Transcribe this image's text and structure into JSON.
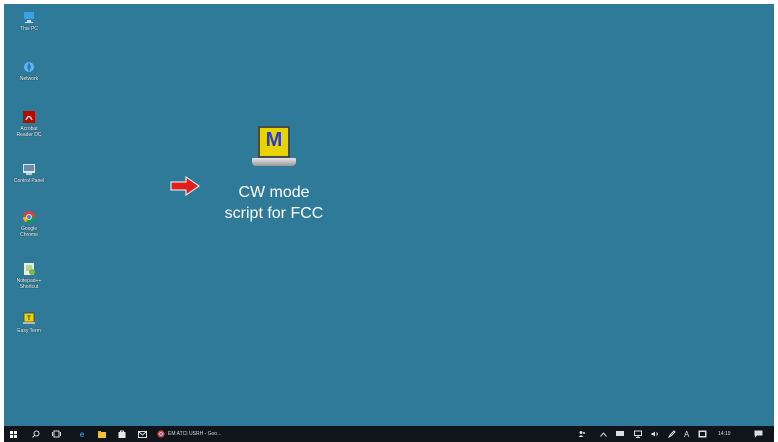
{
  "desktop": {
    "icons": [
      {
        "name": "this-pc",
        "label": "This PC"
      },
      {
        "name": "network",
        "label": "Network"
      },
      {
        "name": "acrobat-reader",
        "label": "Acrobat\nReader DC"
      },
      {
        "name": "control-panel",
        "label": "Control Panel"
      },
      {
        "name": "google-chrome",
        "label": "Google\nChrome"
      },
      {
        "name": "notepad-plus",
        "label": "Notepad++\nShortcut"
      },
      {
        "name": "easy-term",
        "label": "Easy Term"
      }
    ],
    "main_shortcut": {
      "label": "CW mode\nscript for FCC",
      "icon_letter": "M"
    }
  },
  "taskbar": {
    "chrome_task_label": "EM ATCI USRH - Goo...",
    "clock": "14:19",
    "ime_label": "A"
  },
  "colors": {
    "desktop": "#2e7a98",
    "taskbar": "#10151b",
    "arrow": "#e21d1d"
  }
}
